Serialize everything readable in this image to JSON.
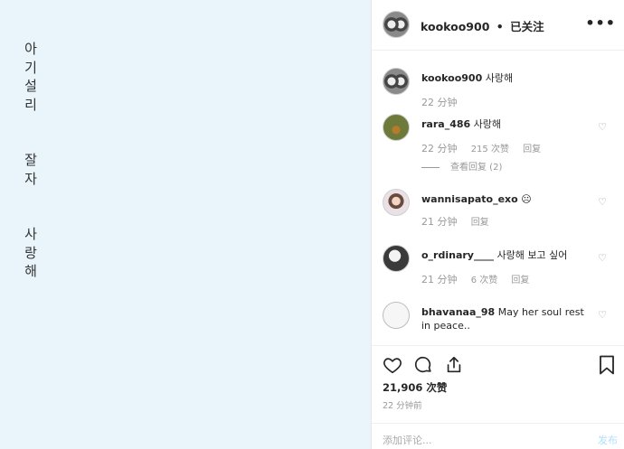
{
  "image_text": {
    "line1": "아",
    "line2": "기",
    "line3": "설",
    "line4": "리",
    "line5": "잘",
    "line6": "자",
    "line7": "사",
    "line8": "랑",
    "line9": "해"
  },
  "header": {
    "username": "kookoo900",
    "separator": "•",
    "follow_status": "已关注",
    "more": "•••"
  },
  "comments": [
    {
      "username": "kookoo900",
      "text": "사랑해",
      "time": "22 分钟",
      "likes": "",
      "reply": ""
    },
    {
      "username": "rara_486",
      "text": "사랑해",
      "time": "22 分钟",
      "likes": "215 次赞",
      "reply": "回复",
      "view_replies": "查看回复 (2)"
    },
    {
      "username": "wannisapato_exo",
      "text": "☹",
      "time": "21 分钟",
      "likes": "",
      "reply": "回复"
    },
    {
      "username": "o_rdinary____",
      "text": "사랑해 보고 싶어",
      "time": "21 分钟",
      "likes": "6 次赞",
      "reply": "回复"
    },
    {
      "username": "bhavanaa_98",
      "text": "May her soul rest in peace..",
      "time": "",
      "likes": "",
      "reply": ""
    }
  ],
  "actions": {
    "likes": "21,906 次赞",
    "time": "22 分钟前",
    "comment_placeholder": "添加评论...",
    "post_label": "发布"
  },
  "icons": {
    "heart": "heart-icon",
    "comment": "comment-icon",
    "share": "share-icon",
    "bookmark": "bookmark-icon",
    "small_heart": "small-heart-icon"
  }
}
